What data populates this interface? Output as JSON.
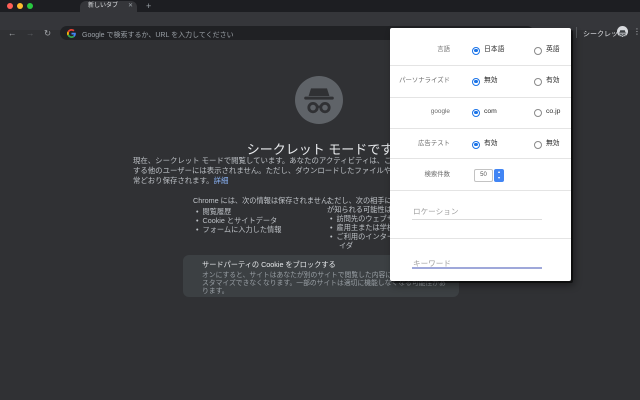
{
  "colors": {
    "accent_blue": "#1a73e8",
    "link_blue": "#8ab4f8",
    "keyword_underline": "#9fa8da",
    "page_bg": "#303134",
    "toolbar_bg": "#35363a",
    "card_bg": "#3c4043"
  },
  "icons": {
    "back": "←",
    "forward": "→",
    "reload": "↻",
    "star": "☆",
    "menu": "⋮",
    "close": "✕",
    "new_tab": "+",
    "spin_up": "▲",
    "spin_down": "▼"
  },
  "window": {
    "tab_title": "新しいタブ",
    "address_placeholder": "Google で検索するか、URL を入力してください",
    "profile_label": "シークレット"
  },
  "page": {
    "title": "シークレット モードです",
    "intro_line1": "現在、シークレット モードで閲覧しています。あなたのアクティビティは、このデバイスを使用",
    "intro_line2": "する他のユーザーには表示されません。ただし、ダウンロードしたファイルやブックマークは通",
    "intro_line3": "常どおり保存されます。",
    "learn_more": "詳細",
    "not_saved": {
      "heading": "Chrome には、次の情報は保存されません。",
      "items": [
        "閲覧履歴",
        "Cookie とサイトデータ",
        "フォームに入力した情報"
      ]
    },
    "visible_to": {
      "heading_line1": "ただし、次の相手にあなたのアクティビティ",
      "heading_line2": "が知られる可能性はあります。",
      "items": [
        "訪問先のウェブサイト",
        "雇用主または学校",
        "ご利用のインターネット サービス プロバ"
      ],
      "item3_wrap": "イダ"
    },
    "cookie_card": {
      "title": "サードパーティの Cookie をブロックする",
      "body_line1": "オンにすると、サイトはあなたが別のサイトで閲覧した内容に基づいて広告をカ",
      "body_line2": "スタマイズできなくなります。一部のサイトは適切に機能しなくなる可能性があ",
      "body_line3": "ります。"
    }
  },
  "popup": {
    "rows": [
      {
        "label": "言語",
        "options": [
          {
            "label": "日本語",
            "selected": true
          },
          {
            "label": "英語",
            "selected": false
          }
        ]
      },
      {
        "label": "パーソナライズド",
        "options": [
          {
            "label": "無効",
            "selected": true
          },
          {
            "label": "有効",
            "selected": false
          }
        ]
      },
      {
        "label": "google",
        "options": [
          {
            "label": "com",
            "selected": true
          },
          {
            "label": "co.jp",
            "selected": false
          }
        ]
      },
      {
        "label": "広告テスト",
        "options": [
          {
            "label": "有効",
            "selected": true
          },
          {
            "label": "無効",
            "selected": false
          }
        ]
      }
    ],
    "count": {
      "label": "検索件数",
      "value": "50"
    },
    "location": {
      "placeholder": "ロケーション"
    },
    "keyword": {
      "placeholder": "キーワード"
    }
  }
}
